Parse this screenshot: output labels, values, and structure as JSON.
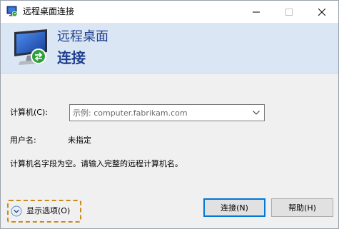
{
  "window": {
    "title": "远程桌面连接"
  },
  "banner": {
    "line1": "远程桌面",
    "line2": "连接"
  },
  "form": {
    "computer_label": "计算机(C):",
    "computer_placeholder": "示例: computer.fabrikam.com",
    "computer_value": "",
    "user_label": "用户名:",
    "user_value": "未指定",
    "message": "计算机名字段为空。请输入完整的远程计算机名。"
  },
  "footer": {
    "options_label": "显示选项(O)",
    "connect_label": "连接(N)",
    "help_label": "帮助(H)"
  },
  "icons": {
    "app": "remote-desktop-icon",
    "minimize": "minimize-icon",
    "maximize": "maximize-icon",
    "close": "close-icon",
    "dropdown": "chevron-down-icon",
    "options": "expand-circle-icon"
  },
  "colors": {
    "banner_bg": "#dbe6f4",
    "banner_text": "#1e3e8f",
    "highlight_dashed": "#c98a1c",
    "default_button_border": "#0078d7"
  }
}
